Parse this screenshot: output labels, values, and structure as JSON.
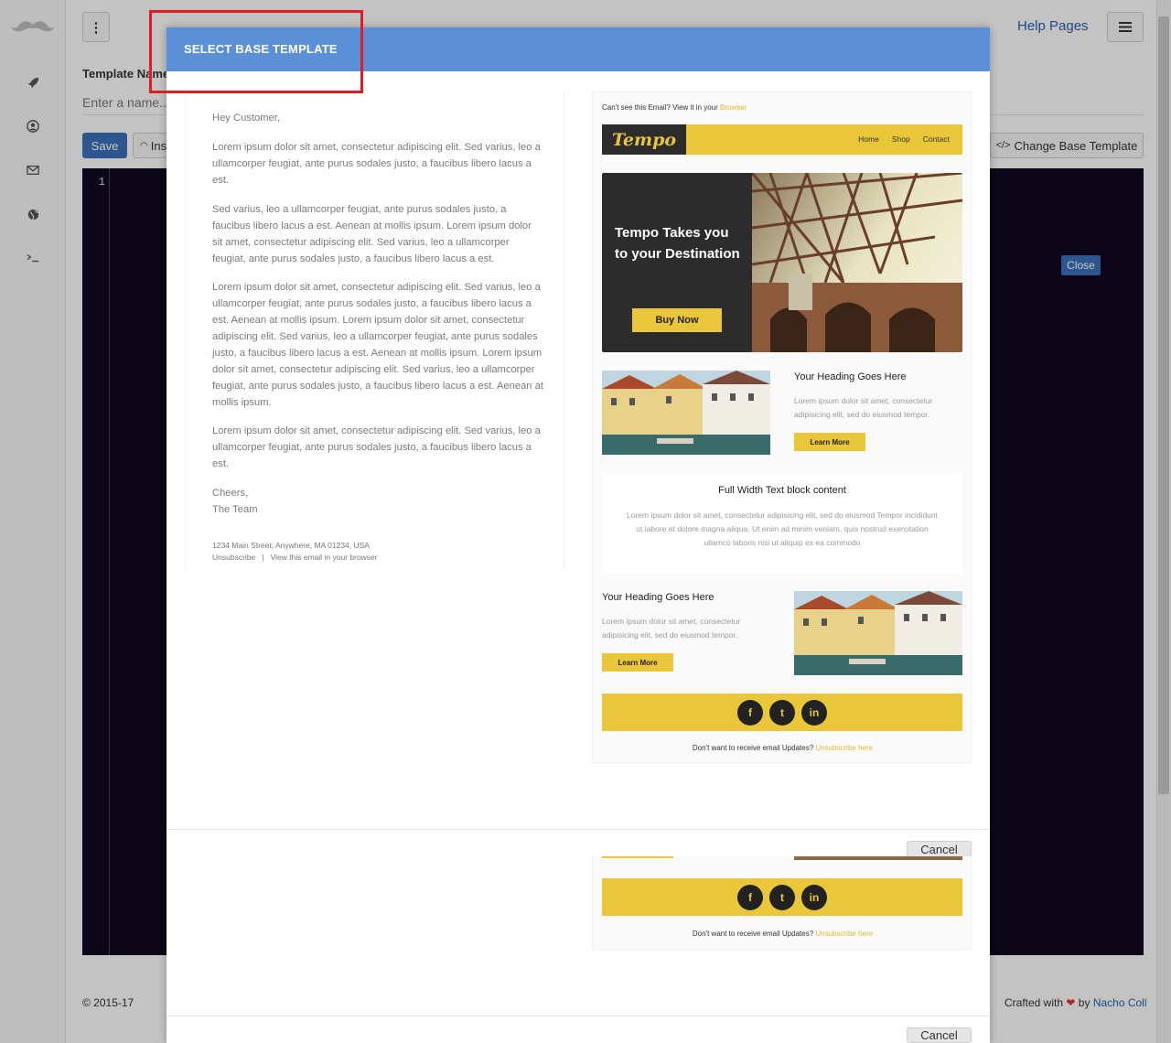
{
  "app": {
    "help_link": "Help Pages",
    "template_name_label": "Template Name",
    "template_name_placeholder": "Enter a name...",
    "save_label": "Save",
    "insert_label": "Insert",
    "change_base_label": "Change Base Template",
    "line_number": "1",
    "close_label": "Close",
    "footer_copyright": "© 2015-17",
    "footer_crafted": "Crafted with",
    "footer_by": "by",
    "footer_author": "Nacho Coll"
  },
  "modal": {
    "title": "SELECT BASE TEMPLATE",
    "cancel_label": "Cancel",
    "plain_template": {
      "greeting": "Hey Customer,",
      "paragraphs": [
        "Lorem ipsum dolor sit amet, consectetur adipiscing elit. Sed varius, leo a ullamcorper feugiat, ante purus sodales justo, a faucibus libero lacus a est.",
        "Sed varius, leo a ullamcorper feugiat, ante purus sodales justo, a faucibus libero lacus a est. Aenean at mollis ipsum. Lorem ipsum dolor sit amet, consectetur adipiscing elit. Sed varius, leo a ullamcorper feugiat, ante purus sodales justo, a faucibus libero lacus a est.",
        "Lorem ipsum dolor sit amet, consectetur adipiscing elit. Sed varius, leo a ullamcorper feugiat, ante purus sodales justo, a faucibus libero lacus a est. Aenean at mollis ipsum. Lorem ipsum dolor sit amet, consectetur adipiscing elit. Sed varius, leo a ullamcorper feugiat, ante purus sodales justo, a faucibus libero lacus a est. Aenean at mollis ipsum. Lorem ipsum dolor sit amet, consectetur adipiscing elit. Sed varius, leo a ullamcorper feugiat, ante purus sodales justo, a faucibus libero lacus a est. Aenean at mollis ipsum.",
        "Lorem ipsum dolor sit amet, consectetur adipiscing elit. Sed varius, leo a ullamcorper feugiat, ante purus sodales justo, a faucibus libero lacus a est."
      ],
      "signoff_1": "Cheers,",
      "signoff_2": "The Team",
      "address": "1234 Main Street, Anywhere, MA 01234, USA",
      "links": "Unsubscribe   |   View this email in your browser"
    },
    "tempo_template": {
      "cant_see": "Can't see this Email? View it in your",
      "browser_link": "Browser",
      "logo": "Tempo",
      "nav": [
        "Home",
        "Shop",
        "Contact"
      ],
      "hero_title": "Tempo Takes you to your Destination",
      "buy_now": "Buy Now",
      "heading": "Your Heading Goes Here",
      "body": "Lorem ipsum dolor sit amet, consectetur adipisicing elit, sed do eiusmod tempor.",
      "learn_more": "Learn More",
      "full_width_title": "Full Width Text block content",
      "full_width_body": "Lorem ipsum dolor sit amet, consectetur adipisicing elit, sed do eiusmod Tempor incididunt ut labore et dolore magna aliqua. Ut enim ad minim veniam, quis nostrud exercitation ullamco laboris nisi ut aliquip ex ea commodo",
      "social": [
        "f",
        "t",
        "in"
      ],
      "dont_want": "Don't want to receive email Updates?",
      "unsubscribe_link": "Unsubscribe here"
    }
  },
  "colors": {
    "header_blue": "#5b8fd6",
    "tempo_yellow": "#e9c63a",
    "tempo_dark": "#2c2c2c",
    "highlight_red": "#e21c23"
  },
  "icons": [
    "mustache-icon",
    "rocket-icon",
    "user-icon",
    "envelope-icon",
    "globe-icon",
    "terminal-icon",
    "vertical-dots-icon",
    "list-icon",
    "heart-icon",
    "code-icon"
  ]
}
